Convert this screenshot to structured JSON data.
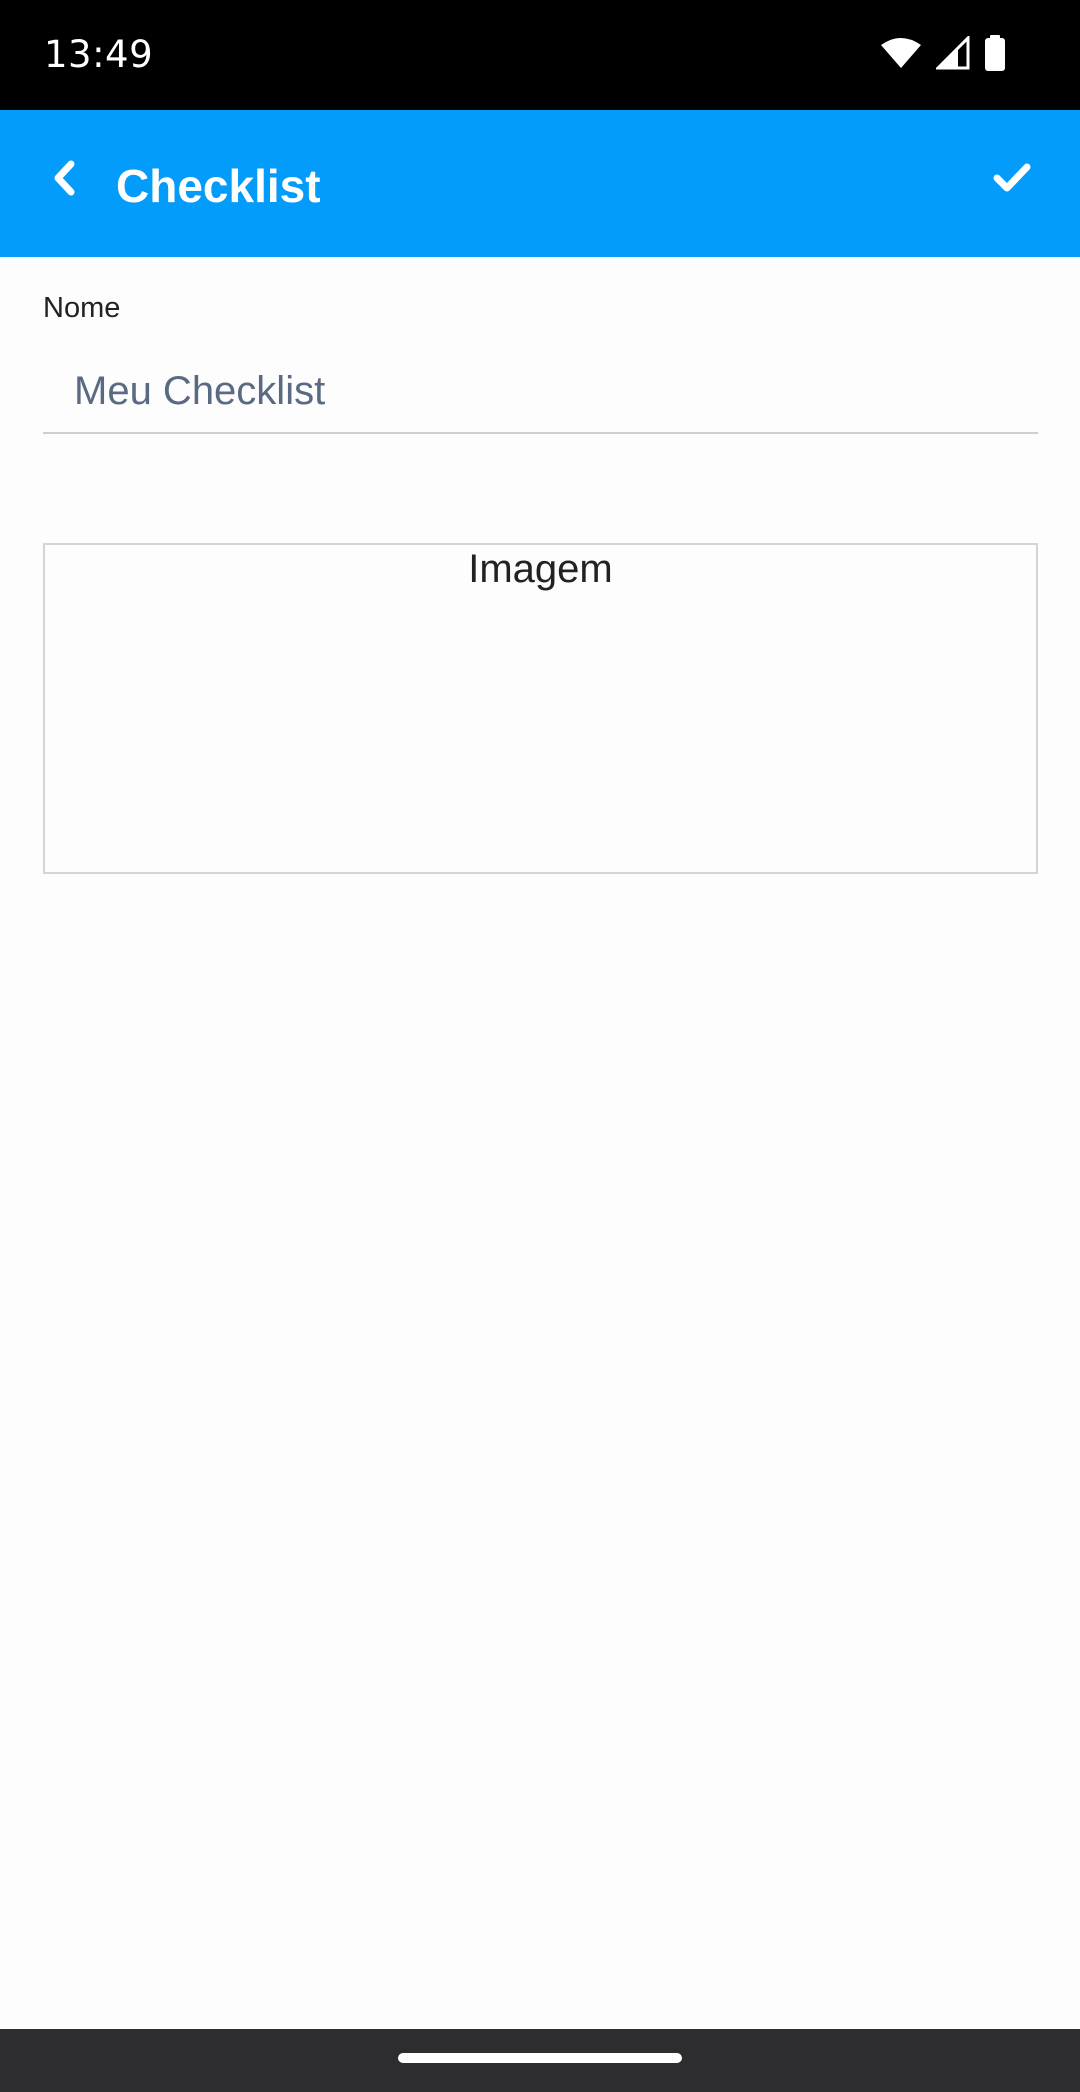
{
  "status_bar": {
    "time": "13:49",
    "icons": [
      "wifi-icon",
      "signal-icon",
      "battery-icon"
    ]
  },
  "app_bar": {
    "title": "Checklist",
    "back_icon": "chevron-left-icon",
    "confirm_icon": "check-icon",
    "color": "#039cfa"
  },
  "form": {
    "name_label": "Nome",
    "name_value": "Meu Checklist",
    "image_label": "Imagem"
  }
}
